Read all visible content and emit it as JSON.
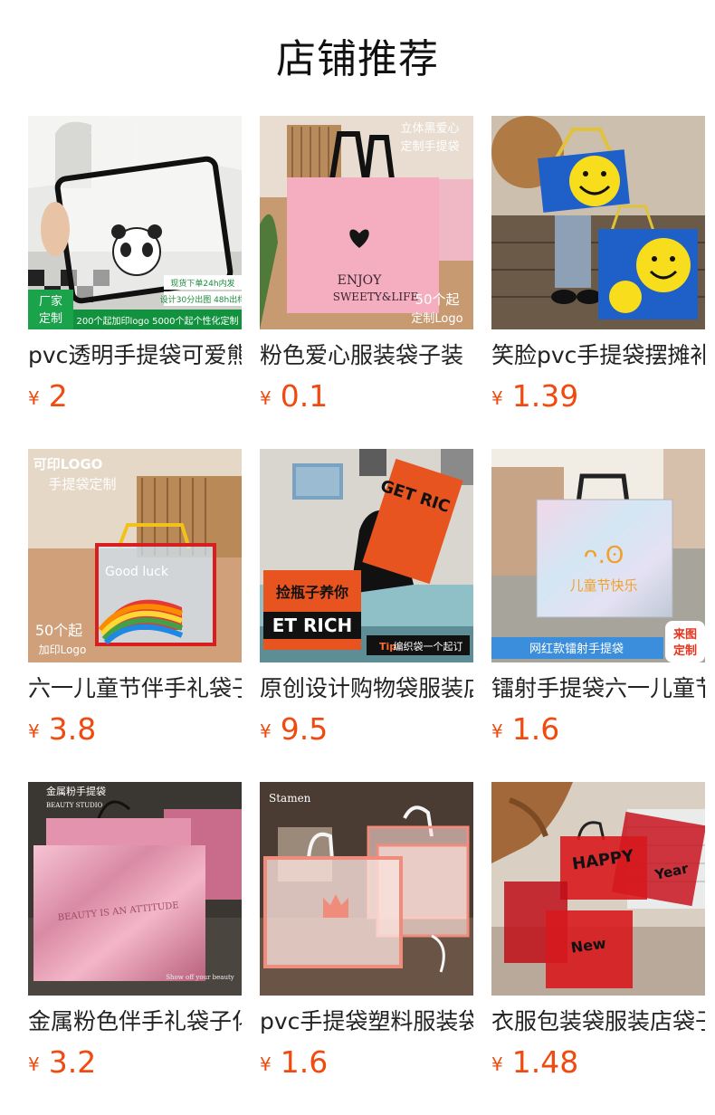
{
  "header": {
    "title": "店铺推荐"
  },
  "currency_symbol": "¥",
  "colors": {
    "price": "#f04a0f",
    "title_text": "#222222"
  },
  "products": [
    {
      "title": "pvc透明手提袋可爱熊",
      "price": "2",
      "image_text": [
        "厂家",
        "定制",
        "200个起加印logo 5000个起个性化定制",
        "现货下单24h内发",
        "设计30分出图 48h出样"
      ]
    },
    {
      "title": "粉色爱心服装袋子装",
      "price": "0.1",
      "image_text": [
        "立体黑爱心",
        "定制手提袋",
        "ENJOY",
        "SWEETY&LIFE",
        "50个起",
        "定制Logo"
      ]
    },
    {
      "title": "笑脸pvc手提袋摆摊补",
      "price": "1.39",
      "image_text": []
    },
    {
      "title": "六一儿童节伴手礼袋子",
      "price": "3.8",
      "image_text": [
        "可印LOGO",
        "手提袋定制",
        "Good luck",
        "50个起",
        "加印Logo"
      ]
    },
    {
      "title": "原创设计购物袋服装店",
      "price": "9.5",
      "image_text": [
        "捡瓶子养你",
        "ET RICH",
        "GET RIC",
        "编织袋一个起订",
        "Tip"
      ]
    },
    {
      "title": "镭射手提袋六一儿童节",
      "price": "1.6",
      "image_text": [
        "儿童节快乐",
        "网红款镭射手提袋",
        "来图",
        "定制"
      ]
    },
    {
      "title": "金属粉色伴手礼袋子化",
      "price": "3.2",
      "image_text": [
        "金属粉手提袋",
        "BEAUTY STUDIO",
        "BEAUTY IS AN ATTITUDE",
        "Show off your beauty"
      ]
    },
    {
      "title": "pvc手提袋塑料服装袋",
      "price": "1.6",
      "image_text": [
        "Stamen"
      ]
    },
    {
      "title": "衣服包装袋服装店袋子",
      "price": "1.48",
      "image_text": [
        "HAPPY",
        "New",
        "Year"
      ]
    }
  ]
}
